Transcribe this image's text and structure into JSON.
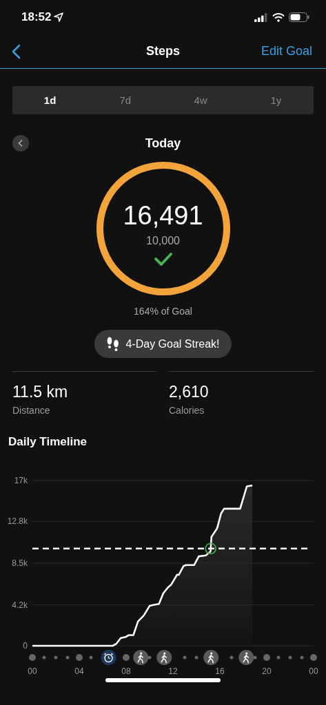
{
  "status_bar": {
    "time": "18:52"
  },
  "nav": {
    "title": "Steps",
    "action": "Edit Goal"
  },
  "tabs": [
    {
      "label": "1d",
      "selected": true
    },
    {
      "label": "7d",
      "selected": false
    },
    {
      "label": "4w",
      "selected": false
    },
    {
      "label": "1y",
      "selected": false
    }
  ],
  "period": {
    "title": "Today"
  },
  "goal_ring": {
    "steps": "16,491",
    "goal": "10,000",
    "level": 1,
    "goal_met": true,
    "percent": "164% of Goal"
  },
  "streak": {
    "label": "4-Day Goal Streak!"
  },
  "stats": [
    {
      "value": "11.5 km",
      "label": "Distance"
    },
    {
      "value": "2,610",
      "label": "Calories"
    }
  ],
  "timeline": {
    "title": "Daily Timeline",
    "chart_data": {
      "type": "area",
      "x": [
        0,
        6.86,
        7.15,
        7.54,
        7.94,
        8.23,
        8.62,
        9.01,
        9.5,
        10,
        10.3,
        10.8,
        11.17,
        11.57,
        11.85,
        12.34,
        12.5,
        12.9,
        13.1,
        13.8,
        14.2,
        14.8,
        15.2,
        15.28,
        15.77,
        16.1,
        16.36,
        17.73,
        18.3,
        18.77
      ],
      "series": [
        {
          "color": "#ffffff",
          "values": [
            0,
            0,
            200,
            800,
            900,
            1100,
            1100,
            2500,
            3100,
            4100,
            4200,
            4300,
            5400,
            6000,
            6300,
            7300,
            7300,
            8200,
            8300,
            8300,
            9200,
            9300,
            9700,
            11200,
            12100,
            13600,
            14100,
            14100,
            16400,
            16500
          ]
        }
      ],
      "xlim": [
        0,
        24
      ],
      "ylim": [
        0,
        17000
      ],
      "xticks": [
        {
          "value": 0,
          "label": "00"
        },
        {
          "value": 4,
          "label": "04"
        },
        {
          "value": 8,
          "label": "08"
        },
        {
          "value": 12,
          "label": "12"
        },
        {
          "value": 16,
          "label": "16"
        },
        {
          "value": 20,
          "label": "20"
        },
        {
          "value": 24,
          "label": "00"
        }
      ],
      "yticks": [
        {
          "value": 0,
          "label": "0"
        },
        {
          "value": 4200,
          "label": "4.2k"
        },
        {
          "value": 8500,
          "label": "8.5k"
        },
        {
          "value": 12800,
          "label": "12.8k"
        },
        {
          "value": 17000,
          "label": "17k"
        }
      ],
      "grid": true,
      "ref_lines": [
        {
          "axis": "y",
          "value": 10000
        }
      ]
    },
    "activity_slots": [
      {
        "kind": "dot"
      },
      {
        "kind": "dot"
      },
      {
        "kind": "dot"
      },
      {
        "kind": "dot"
      },
      {
        "kind": "dot"
      },
      {
        "kind": "dot"
      },
      {
        "kind": "alarm"
      },
      {
        "kind": "empty"
      },
      {
        "kind": "dot"
      },
      {
        "kind": "walk"
      },
      {
        "kind": "dot"
      },
      {
        "kind": "walk"
      },
      {
        "kind": "empty"
      },
      {
        "kind": "dot"
      },
      {
        "kind": "dot"
      },
      {
        "kind": "walk"
      },
      {
        "kind": "empty"
      },
      {
        "kind": "dot"
      },
      {
        "kind": "walk"
      },
      {
        "kind": "dot"
      },
      {
        "kind": "dot"
      },
      {
        "kind": "dot"
      },
      {
        "kind": "dot"
      },
      {
        "kind": "dot"
      },
      {
        "kind": "dot"
      }
    ]
  }
}
